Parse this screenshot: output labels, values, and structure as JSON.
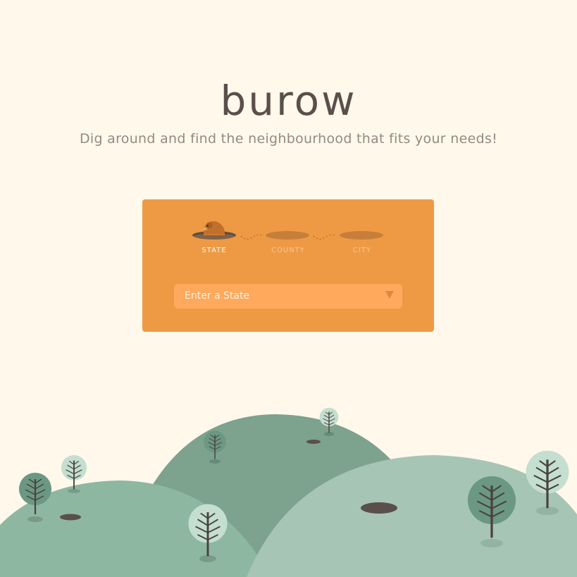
{
  "header": {
    "logo_text": "burow",
    "tagline": "Dig around and find the neighbourhood that fits your needs!"
  },
  "wizard": {
    "steps": [
      {
        "label": "STATE",
        "active": true
      },
      {
        "label": "COUNTY",
        "active": false
      },
      {
        "label": "CITY",
        "active": false
      }
    ],
    "select": {
      "placeholder": "Enter a State",
      "value": ""
    }
  },
  "colors": {
    "background": "#fff8eb",
    "card": "#ee9a45",
    "select_field": "#ffa95c",
    "text_dark": "#5a4f4a"
  },
  "icons": [
    "gopher-icon",
    "burrow-hole-icon",
    "chevron-down-icon",
    "tree-icon",
    "hill-icon"
  ]
}
